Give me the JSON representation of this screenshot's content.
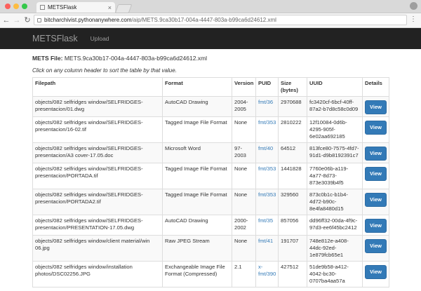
{
  "browser": {
    "tab_title": "METSFlask",
    "tab_close": "×",
    "url_host": "bitcharchivist.pythonanywhere.com",
    "url_path": "/aip/METS.9ca30b17-004a-4447-803a-b99ca6d24612.xml"
  },
  "navbar": {
    "brand": "METSFlask",
    "upload": "Upload"
  },
  "mets_label": "METS File:",
  "mets_file": "METS.9ca30b17-004a-4447-803a-b99ca6d24612.xml",
  "hint": "Click on any column header to sort the table by that value.",
  "table": {
    "headers": [
      "Filepath",
      "Format",
      "Version",
      "PUID",
      "Size (bytes)",
      "UUID",
      "Details"
    ],
    "view_label": "View",
    "rows": [
      {
        "path": "objects/082 selfridges window/SELFRIDGES-presentacion/01.dwg",
        "format": "AutoCAD Drawing",
        "version": "2004-2005",
        "puid": "fmt/36",
        "size": "2970688",
        "uuid": "fc3420cf-6bcf-40ff-87a2-b7d8c58c0d09"
      },
      {
        "path": "objects/082 selfridges window/SELFRIDGES-presentacion/16-02.tif",
        "format": "Tagged Image File Format",
        "version": "None",
        "puid": "fmt/353",
        "size": "2810222",
        "uuid": "12f10084-0d6b-4295-905f-6e02aa692185"
      },
      {
        "path": "objects/082 selfridges window/SELFRIDGES-presentacion/A3 cover-17.05.doc",
        "format": "Microsoft Word",
        "version": "97-2003",
        "puid": "fmt/40",
        "size": "64512",
        "uuid": "813fce80-7575-4fd7-91d1-d9b8192391c7"
      },
      {
        "path": "objects/082 selfridges window/SELFRIDGES-presentacion/PORTADA.tif",
        "format": "Tagged Image File Format",
        "version": "None",
        "puid": "fmt/353",
        "size": "1441828",
        "uuid": "7760e06b-a119-4a77-8d73-873e3039b4f5"
      },
      {
        "path": "objects/082 selfridges window/SELFRIDGES-presentacion/PORTADA2.tif",
        "format": "Tagged Image File Format",
        "version": "None",
        "puid": "fmt/353",
        "size": "329560",
        "uuid": "873c0b1c-b1b4-4d72-b90c-8e4fa8480d15"
      },
      {
        "path": "objects/082 selfridges window/SELFRIDGES-presentacion/PRESENTATION-17.05.dwg",
        "format": "AutoCAD Drawing",
        "version": "2000-2002",
        "puid": "fmt/35",
        "size": "857056",
        "uuid": "dd96ff32-00da-4f9c-97d3-ee6f45bc2412"
      },
      {
        "path": "objects/082 selfridges window/client material/win 06.jpg",
        "format": "Raw JPEG Stream",
        "version": "None",
        "puid": "fmt/41",
        "size": "191707",
        "uuid": "748e812e-a408-44dc-92ed-1e879fcb65e1"
      },
      {
        "path": "objects/082 selfridges window/installation photos/DSC02256.JPG",
        "format": "Exchangeable Image File Format (Compressed)",
        "version": "2.1",
        "puid": "x-fmt/390",
        "size": "427512",
        "uuid": "51de9b58-a412-4042-bc30-0707ba4aa57a"
      }
    ]
  }
}
